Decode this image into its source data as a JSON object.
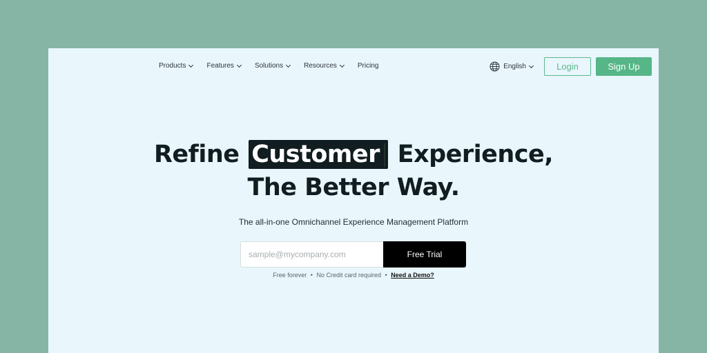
{
  "nav": {
    "items": [
      {
        "label": "Products",
        "has_dropdown": true
      },
      {
        "label": "Features",
        "has_dropdown": true
      },
      {
        "label": "Solutions",
        "has_dropdown": true
      },
      {
        "label": "Resources",
        "has_dropdown": true
      },
      {
        "label": "Pricing",
        "has_dropdown": false
      }
    ],
    "language": {
      "icon": "globe-icon",
      "label": "English"
    },
    "login_label": "Login",
    "signup_label": "Sign Up"
  },
  "hero": {
    "line1_before": "Refine",
    "highlight": "Customer",
    "line1_after": "Experience,",
    "line2": "The Better Way.",
    "subtitle": "The all-in-one Omnichannel Experience Management Platform"
  },
  "signup_form": {
    "email_placeholder": "sample@mycompany.com",
    "email_value": "",
    "submit_label": "Free Trial"
  },
  "fineprint": {
    "item1": "Free forever",
    "item2": "No Credit card required",
    "separator": "•",
    "demo_link": "Need a Demo?"
  },
  "colors": {
    "outer_background": "#86b5a6",
    "page_background": "#e9f6fc",
    "accent_green": "#56b688",
    "headline_dark": "#111d20"
  }
}
